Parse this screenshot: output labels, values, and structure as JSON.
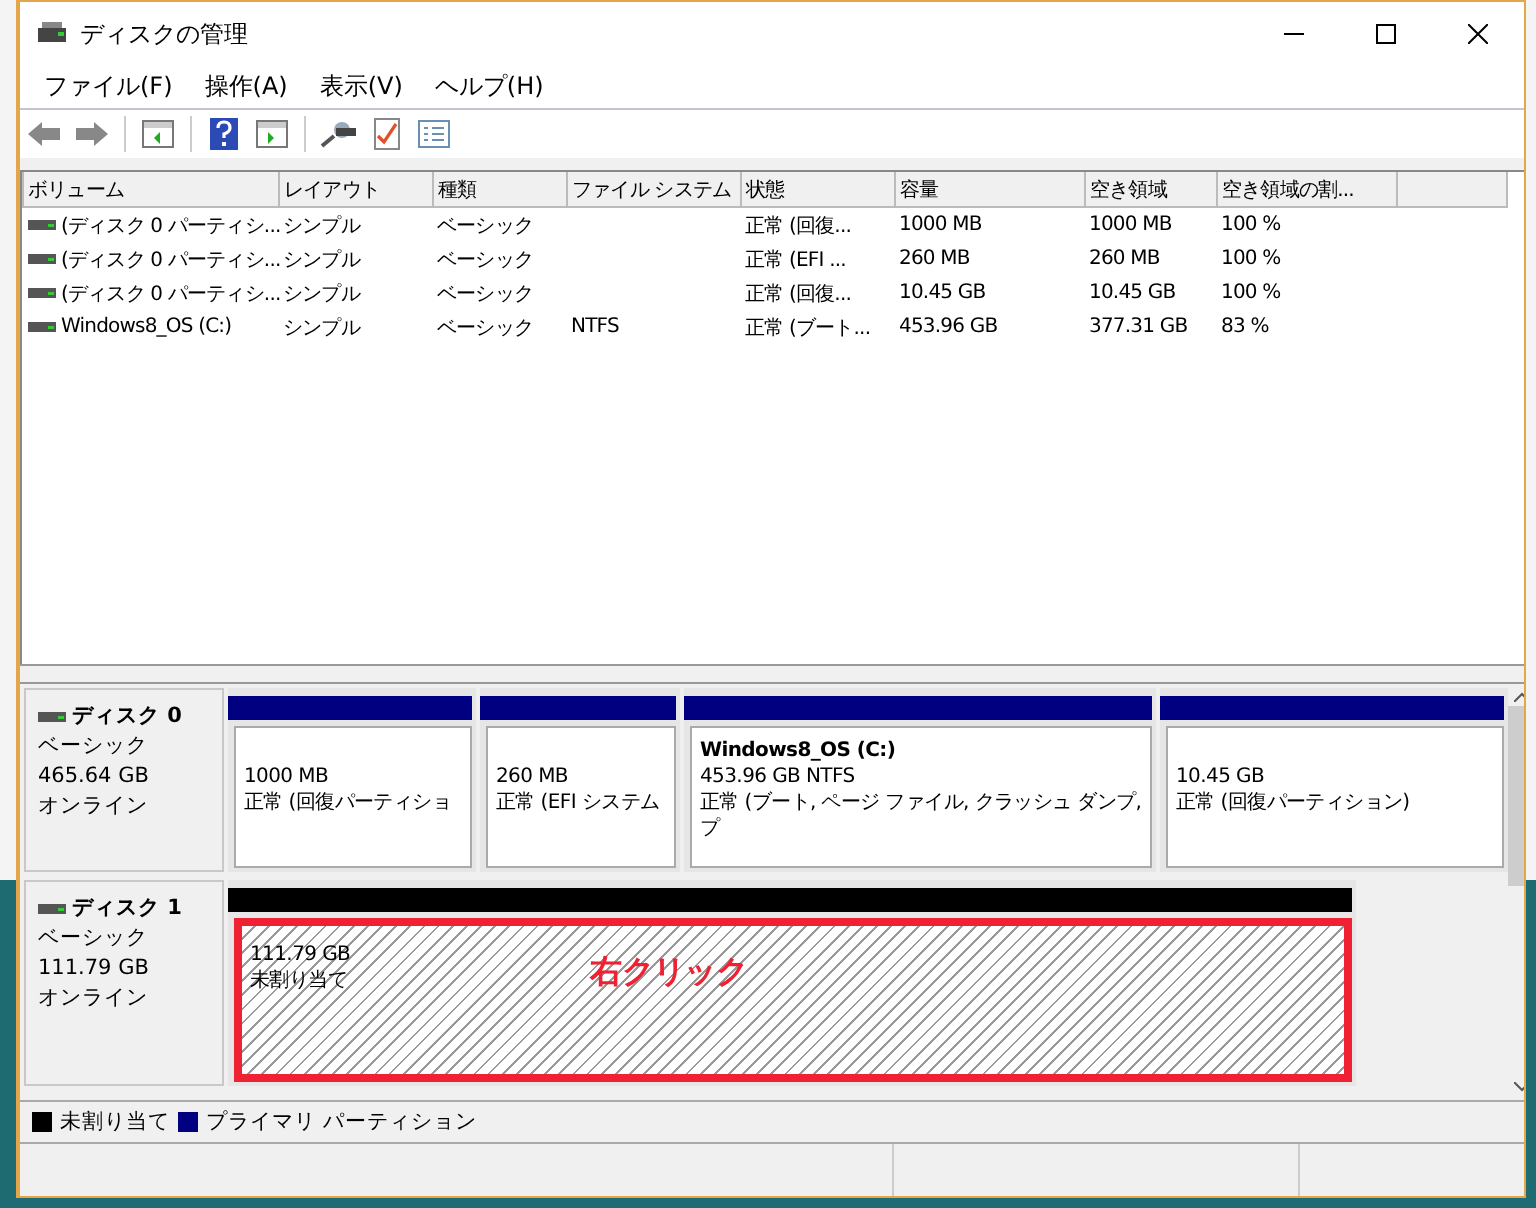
{
  "window": {
    "title": "ディスクの管理"
  },
  "menu": [
    {
      "label": "ファイル(F)"
    },
    {
      "label": "操作(A)"
    },
    {
      "label": "表示(V)"
    },
    {
      "label": "ヘルプ(H)"
    }
  ],
  "table": {
    "columns": [
      "ボリューム",
      "レイアウト",
      "種類",
      "ファイル システム",
      "状態",
      "容量",
      "空き領域",
      "空き領域の割..."
    ],
    "rows": [
      {
        "cells": [
          "(ディスク 0 パーティシ...",
          "シンプル",
          "ベーシック",
          "",
          "正常 (回復...",
          "1000 MB",
          "1000 MB",
          "100 %"
        ]
      },
      {
        "cells": [
          "(ディスク 0 パーティシ...",
          "シンプル",
          "ベーシック",
          "",
          "正常 (EFI ...",
          "260 MB",
          "260 MB",
          "100 %"
        ]
      },
      {
        "cells": [
          "(ディスク 0 パーティシ...",
          "シンプル",
          "ベーシック",
          "",
          "正常 (回復...",
          "10.45 GB",
          "10.45 GB",
          "100 %"
        ]
      },
      {
        "cells": [
          "Windows8_OS (C:)",
          "シンプル",
          "ベーシック",
          "NTFS",
          "正常 (ブート...",
          "453.96 GB",
          "377.31 GB",
          "83 %"
        ]
      }
    ]
  },
  "disks": [
    {
      "name": "ディスク 0",
      "type": "ベーシック",
      "size": "465.64 GB",
      "status": "オンライン",
      "partitions": [
        {
          "kind": "primary",
          "lines": [
            "1000 MB",
            "正常 (回復パーティショ"
          ]
        },
        {
          "kind": "primary",
          "lines": [
            "260 MB",
            "正常 (EFI システム"
          ]
        },
        {
          "kind": "primary",
          "title": "Windows8_OS  (C:)",
          "lines": [
            "453.96 GB NTFS",
            "正常 (ブート, ページ ファイル, クラッシュ ダンプ, プ"
          ]
        },
        {
          "kind": "primary",
          "lines": [
            "10.45 GB",
            "正常 (回復パーティション)"
          ]
        }
      ]
    },
    {
      "name": "ディスク 1",
      "type": "ベーシック",
      "size": "111.79 GB",
      "status": "オンライン",
      "partitions": [
        {
          "kind": "unallocated",
          "lines": [
            "111.79 GB",
            "未割り当て"
          ],
          "annotation": "右クリック"
        }
      ]
    }
  ],
  "legend": [
    {
      "label": "未割り当て",
      "color": "#000000"
    },
    {
      "label": "プライマリ パーティション",
      "color": "#000080"
    }
  ]
}
